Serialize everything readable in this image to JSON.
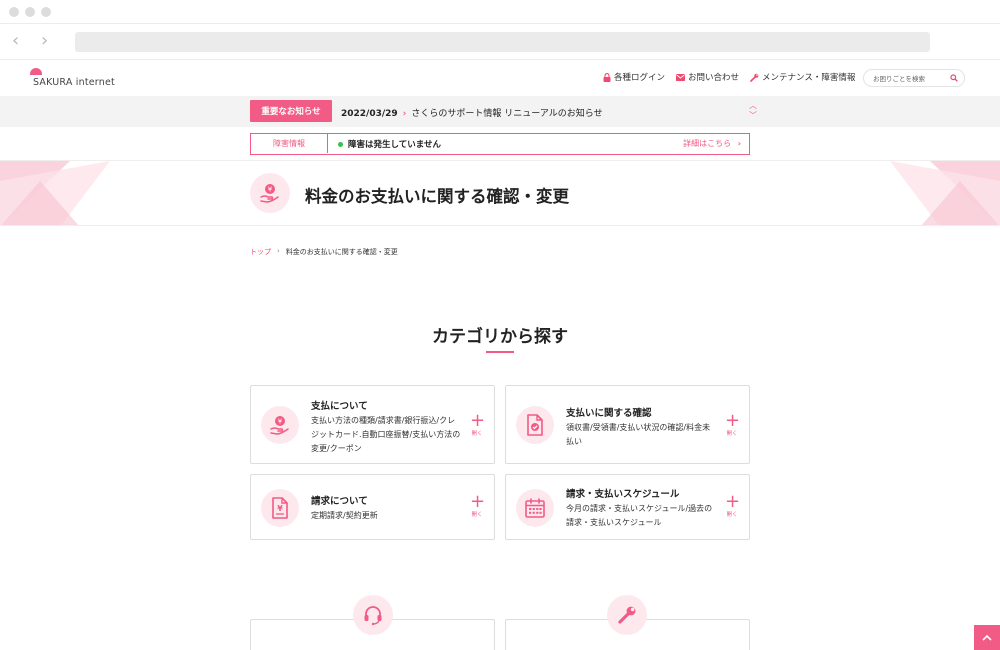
{
  "browser": {
    "dots": 3
  },
  "header": {
    "logo_text": "SAKURA internet",
    "nav": [
      {
        "label": "各種ログイン",
        "icon": "lock-icon"
      },
      {
        "label": "お問い合わせ",
        "icon": "mail-icon"
      },
      {
        "label": "メンテナンス・障害情報",
        "icon": "wrench-icon"
      }
    ],
    "search_placeholder": "お困りごとを検索"
  },
  "notice": {
    "tag": "重要なお知らせ",
    "date": "2022/03/29",
    "text": "さくらのサポート情報 リニューアルのお知らせ"
  },
  "fault": {
    "tag": "障害情報",
    "status": "障害は発生していません",
    "detail": "詳細はこちら"
  },
  "hero": {
    "title": "料金のお支払いに関する確認・変更"
  },
  "breadcrumb": {
    "home": "トップ",
    "current": "料金のお支払いに関する確認・変更"
  },
  "section": {
    "title": "カテゴリから探す"
  },
  "cards": [
    {
      "title": "支払について",
      "desc": "支払い方法の種類/請求書/銀行振込/クレジットカード.自動口座振替/支払い方法の変更/クーポン",
      "open": "開く",
      "icon": "yen-hand-icon"
    },
    {
      "title": "支払いに関する確認",
      "desc": "領収書/受領書/支払い状況の確認/料金未払い",
      "open": "開く",
      "icon": "document-check-icon"
    },
    {
      "title": "請求について",
      "desc": "定期請求/契約更新",
      "open": "開く",
      "icon": "yen-document-icon"
    },
    {
      "title": "請求・支払いスケジュール",
      "desc": "今月の請求・支払いスケジュール/過去の請求・支払いスケジュール",
      "open": "開く",
      "icon": "calendar-icon"
    }
  ],
  "colors": {
    "accent": "#f25b85",
    "accent_light": "#fde8ee",
    "status_ok": "#34c24a"
  }
}
